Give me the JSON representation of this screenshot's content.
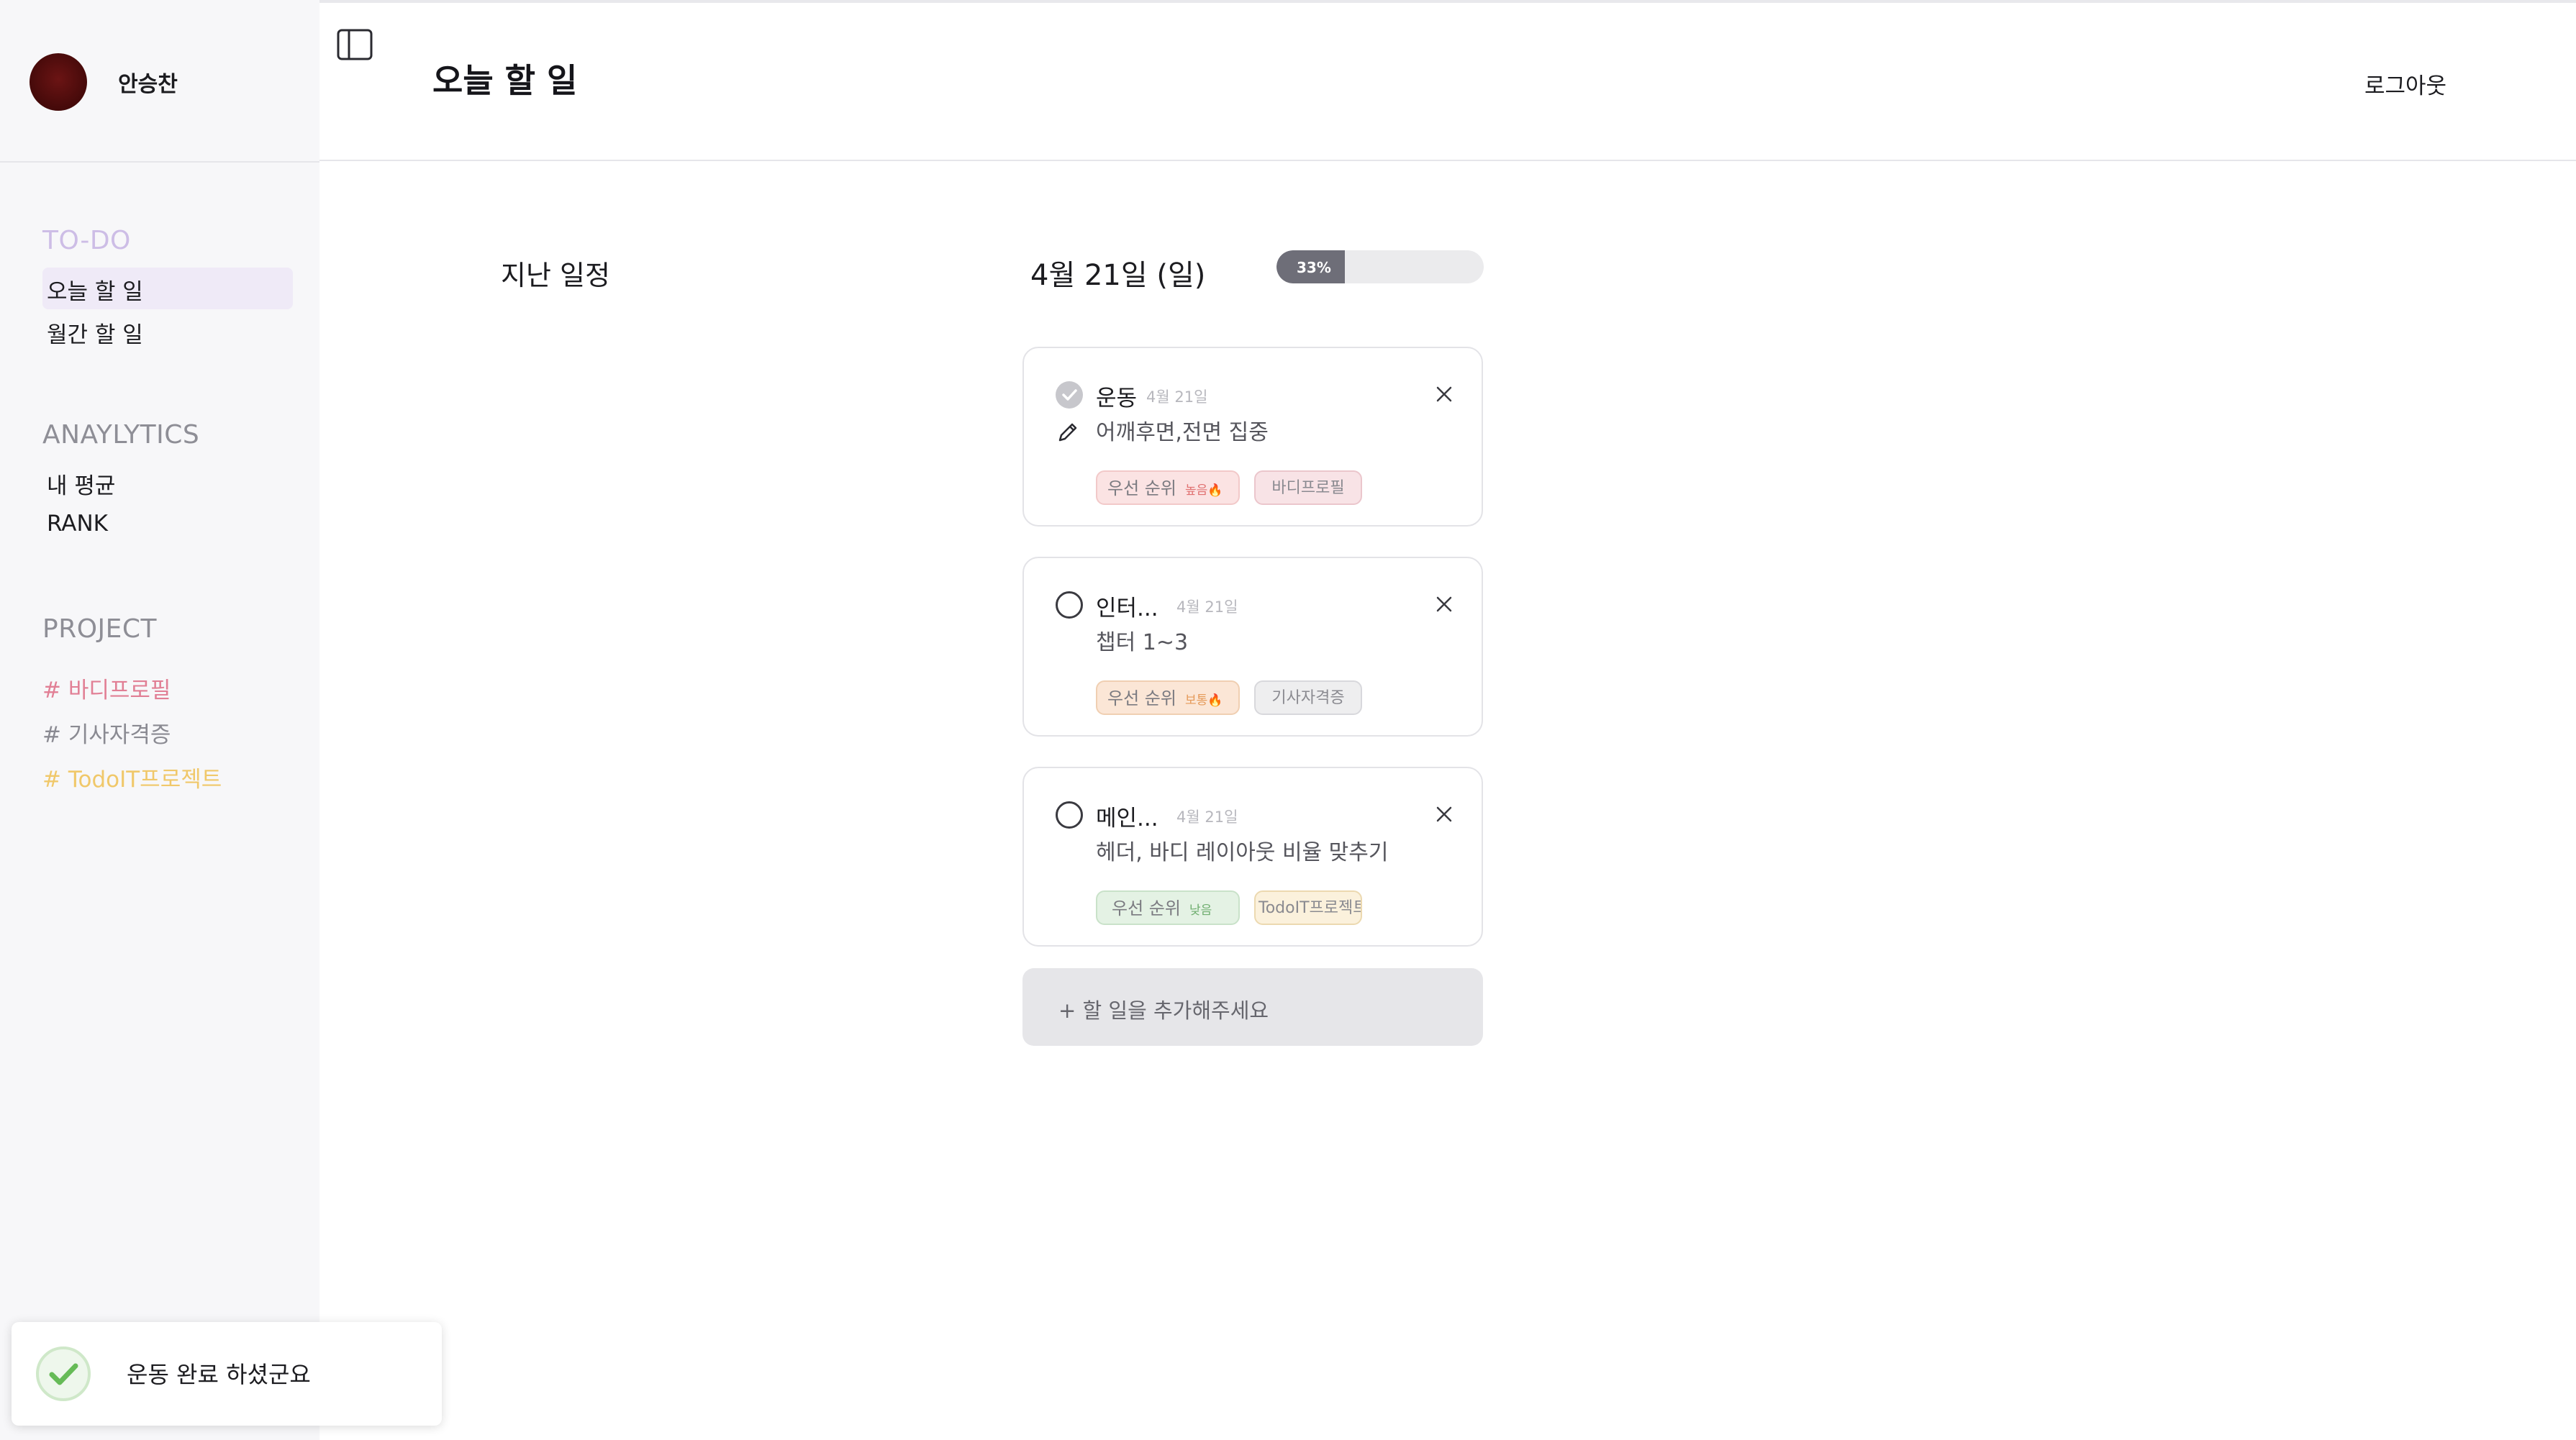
{
  "user": {
    "name": "안승찬"
  },
  "header": {
    "title": "오늘 할 일",
    "logout_label": "로그아웃"
  },
  "sidebar": {
    "sections": [
      {
        "title": "TO-DO",
        "color": "#cdbde6",
        "items": [
          {
            "label": "오늘 할 일",
            "active": true
          },
          {
            "label": "월간 할 일",
            "active": false
          }
        ]
      },
      {
        "title": "ANAYLYTICS",
        "color": "#8e8e96",
        "items": [
          {
            "label": "내 평균",
            "active": false
          },
          {
            "label": "RANK",
            "active": false
          }
        ]
      },
      {
        "title": "PROJECT",
        "color": "#8e8e96",
        "tags": [
          {
            "label": "# 바디프로필",
            "color": "#e17f95"
          },
          {
            "label": "# 기사자격증",
            "color": "#8a8a92"
          },
          {
            "label": "# TodoIT프로젝트",
            "color": "#f0c86a"
          }
        ]
      }
    ]
  },
  "main": {
    "past_title": "지난 일정",
    "date_title": "4월 21일 (일)",
    "progress": {
      "percent": 33,
      "label": "33%"
    },
    "tasks": [
      {
        "title": "운동",
        "date": "4월 21일",
        "description": "어깨후면,전면 집중",
        "done": true,
        "priority_label": "우선 순위",
        "priority_level": "높음🔥",
        "priority_bg": "#fbe3e3",
        "priority_border": "#f2c9c9",
        "priority_level_color": "#e07070",
        "project": "바디프로필",
        "project_bg": "#f8e3e6",
        "project_border": "#ebc6cc"
      },
      {
        "title": "인터...",
        "date": "4월 21일",
        "description": "챕터 1~3",
        "done": false,
        "priority_label": "우선 순위",
        "priority_level": "보통🔥",
        "priority_bg": "#fbe6d6",
        "priority_border": "#f0cfb2",
        "priority_level_color": "#e59a5a",
        "project": "기사자격증",
        "project_bg": "#eeeeef",
        "project_border": "#d8d8dc"
      },
      {
        "title": "메인...",
        "date": "4월 21일",
        "description": "헤더, 바디 레이아웃 비율 맞추기",
        "done": false,
        "priority_label": "우선 순위",
        "priority_level": "낮음",
        "priority_bg": "#e4f2e4",
        "priority_border": "#c9e2c9",
        "priority_level_color": "#6fae6f",
        "project": "TodoIT프로젝트",
        "project_bg": "#fbf1dc",
        "project_border": "#ecd9b0"
      }
    ],
    "add_placeholder": "+ 할 일을 추가해주세요"
  },
  "toast": {
    "message": "운동 완료 하셨군요"
  },
  "icons": {
    "sidebar_toggle": "sidebar-toggle-icon",
    "close": "close-icon",
    "check": "check-icon",
    "pencil": "pencil-icon"
  }
}
